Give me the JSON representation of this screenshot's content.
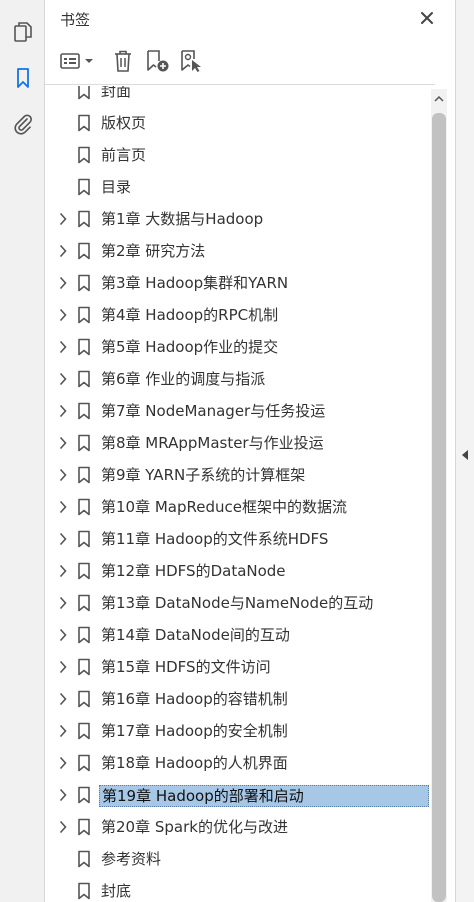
{
  "panel": {
    "title": "书签",
    "close_icon": "close-icon"
  },
  "rail": {
    "items": [
      {
        "name": "pages-thumbnail",
        "icon": "pages-icon"
      },
      {
        "name": "bookmarks",
        "icon": "bookmark-icon"
      },
      {
        "name": "attachments",
        "icon": "paperclip-icon"
      }
    ]
  },
  "toolbar": {
    "buttons": [
      {
        "name": "options-menu",
        "icon": "list-options-icon"
      },
      {
        "name": "delete-bookmark",
        "icon": "trash-icon"
      },
      {
        "name": "new-bookmark",
        "icon": "add-bookmark-icon"
      },
      {
        "name": "bookmark-from-selection",
        "icon": "bookmark-cursor-icon"
      }
    ]
  },
  "bookmarks": [
    {
      "label": "封面",
      "expandable": false
    },
    {
      "label": "版权页",
      "expandable": false
    },
    {
      "label": "前言页",
      "expandable": false
    },
    {
      "label": "目录",
      "expandable": false
    },
    {
      "label": "第1章 大数据与Hadoop",
      "expandable": true
    },
    {
      "label": "第2章 研究方法",
      "expandable": true
    },
    {
      "label": "第3章 Hadoop集群和YARN",
      "expandable": true
    },
    {
      "label": "第4章 Hadoop的RPC机制",
      "expandable": true
    },
    {
      "label": "第5章 Hadoop作业的提交",
      "expandable": true
    },
    {
      "label": "第6章 作业的调度与指派",
      "expandable": true
    },
    {
      "label": "第7章 NodeManager与任务投运",
      "expandable": true
    },
    {
      "label": "第8章 MRAppMaster与作业投运",
      "expandable": true
    },
    {
      "label": "第9章 YARN子系统的计算框架",
      "expandable": true
    },
    {
      "label": "第10章 MapReduce框架中的数据流",
      "expandable": true
    },
    {
      "label": "第11章 Hadoop的文件系统HDFS",
      "expandable": true
    },
    {
      "label": "第12章 HDFS的DataNode",
      "expandable": true
    },
    {
      "label": "第13章 DataNode与NameNode的互动",
      "expandable": true
    },
    {
      "label": "第14章 DataNode间的互动",
      "expandable": true
    },
    {
      "label": "第15章 HDFS的文件访问",
      "expandable": true
    },
    {
      "label": "第16章 Hadoop的容错机制",
      "expandable": true
    },
    {
      "label": "第17章 Hadoop的安全机制",
      "expandable": true
    },
    {
      "label": "第18章 Hadoop的人机界面",
      "expandable": true
    },
    {
      "label": "第19章 Hadoop的部署和启动",
      "expandable": true,
      "selected": true
    },
    {
      "label": "第20章 Spark的优化与改进",
      "expandable": true
    },
    {
      "label": "参考资料",
      "expandable": false
    },
    {
      "label": "封底",
      "expandable": false
    }
  ],
  "colors": {
    "selection": "#a6c8e6",
    "active_rail_icon": "#1473e6",
    "icon": "#555555"
  }
}
